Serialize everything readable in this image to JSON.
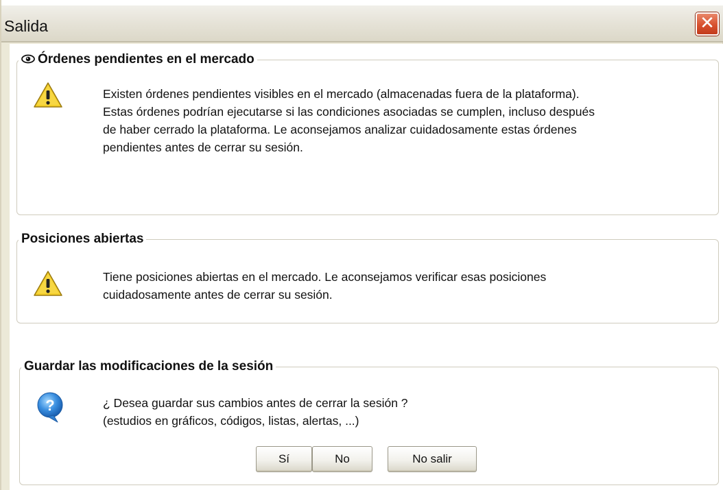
{
  "window": {
    "title": "Salida",
    "close_label": "✕"
  },
  "pending_orders": {
    "legend_icon": "eye-icon",
    "legend": "Órdenes pendientes en el mercado",
    "icon": "warning-icon",
    "message": "Existen órdenes pendientes visibles en el mercado (almacenadas fuera de la plataforma).\nEstas órdenes podrían ejecutarse si las condiciones asociadas se cumplen, incluso después\nde haber cerrado la plataforma. Le aconsejamos analizar cuidadosamente estas órdenes\npendientes antes de cerrar su sesión."
  },
  "open_positions": {
    "legend": "Posiciones abiertas",
    "icon": "warning-icon",
    "message": "Tiene posiciones abiertas en el mercado. Le aconsejamos verificar esas posiciones\ncuidadosamente antes de cerrar su sesión."
  },
  "save_changes": {
    "legend": "Guardar las modificaciones de la sesión",
    "icon": "question-icon",
    "question": "¿ Desea guardar sus cambios antes de cerrar la sesión ?",
    "detail": "(estudios en gráficos, códigos, listas, alertas, ...)",
    "buttons": {
      "yes": "Sí",
      "no": "No",
      "cancel": "No salir"
    }
  },
  "colors": {
    "close_button": "#d8512f",
    "warning_fill": "#f4cf2a",
    "help_fill": "#3a8fe0"
  }
}
